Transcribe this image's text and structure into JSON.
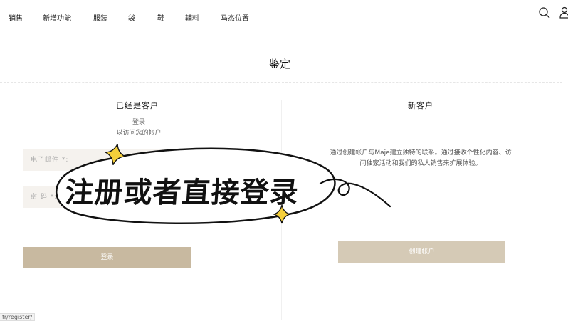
{
  "nav": {
    "items": [
      "销售",
      "新增功能",
      "服装",
      "袋",
      "鞋",
      "辅料",
      "马杰位置"
    ],
    "search_icon": "search-icon",
    "account_icon": "user-icon"
  },
  "page": {
    "title": "鉴定"
  },
  "existing": {
    "title": "已经是客户",
    "line1": "登录",
    "line2": "以访问您的帐户",
    "email_placeholder": "电子邮件 *:",
    "password_placeholder": "密 码 *:",
    "login_button": "登录"
  },
  "new_customer": {
    "title": "新客户",
    "description": "通过创建帐户与Maje建立独特的联系。通过接收个性化内容、访问独家活动和我们的私人销售来扩展体验。",
    "create_button": "创建帐户"
  },
  "status_url": "fr/register/",
  "overlay": {
    "text": "注册或者直接登录"
  },
  "colors": {
    "button": "#c8b9a0",
    "button_light": "#d5cab6",
    "field_bg": "#f5f2ee",
    "sparkle": "#f5cf3a"
  }
}
